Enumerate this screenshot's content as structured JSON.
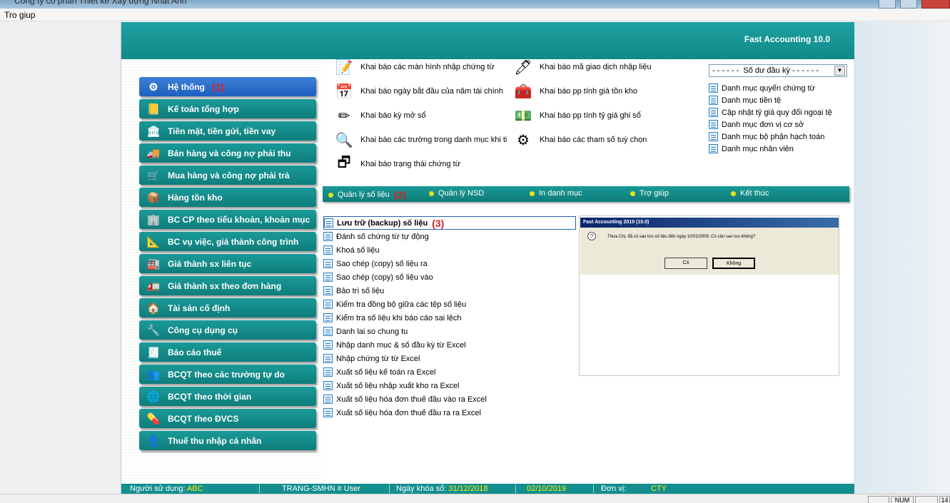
{
  "window": {
    "title": "Công ty cổ phần Thiết kế Xây dựng Nhật Anh"
  },
  "menu": {
    "help": "Tro giup"
  },
  "header": {
    "product": "Fast Accounting 10.0"
  },
  "sidebar": {
    "items": [
      {
        "label": "Hệ thống",
        "num": "(1)",
        "icon": "gear-icon"
      },
      {
        "label": "Kế toán tổng hợp",
        "icon": "ledger-icon"
      },
      {
        "label": "Tiền mặt, tiền gửi, tiền vay",
        "icon": "bank-icon"
      },
      {
        "label": "Bán hàng và công nợ phải thu",
        "icon": "truck-icon"
      },
      {
        "label": "Mua hàng và công nợ phải trả",
        "icon": "cart-icon"
      },
      {
        "label": "Hàng tồn kho",
        "icon": "warehouse-icon"
      },
      {
        "label": "BC CP theo tiểu khoản, khoản mục",
        "icon": "building-icon"
      },
      {
        "label": "BC vụ việc, giá thành công trình",
        "icon": "construction-icon"
      },
      {
        "label": "Giá thành sx liên tục",
        "icon": "conveyor-icon"
      },
      {
        "label": "Giá thành sx theo đơn hàng",
        "icon": "delivery-icon"
      },
      {
        "label": "Tài sản cố định",
        "icon": "house-icon"
      },
      {
        "label": "Công cụ dụng cụ",
        "icon": "tools-icon"
      },
      {
        "label": "Báo cáo thuế",
        "icon": "tax-report-icon"
      },
      {
        "label": "BCQT theo các trường tự do",
        "icon": "people-icon"
      },
      {
        "label": "BCQT theo thời gian",
        "icon": "globe-icon"
      },
      {
        "label": "BCQT theo ĐVCS",
        "icon": "pill-icon"
      },
      {
        "label": "Thuế thu nhập cá nhân",
        "icon": "person-icon"
      }
    ]
  },
  "config": {
    "items": [
      {
        "label": "Khai báo các màn hình nhập chứng từ",
        "icon": "form-edit-icon"
      },
      {
        "label": "Khai báo ngày bắt đầu của năm tài chính",
        "icon": "calendar-icon"
      },
      {
        "label": "Khai báo kỳ mở sổ",
        "icon": "tools-pencil-icon"
      },
      {
        "label": "Khai báo các trường trong danh mục khi ti",
        "icon": "magnifier-icon"
      },
      {
        "label": "Khai báo trạng thái chứng từ",
        "icon": "windows-icon"
      },
      {
        "label": "Khai báo mã giao dịch nhập liệu",
        "icon": "document-pen-icon"
      },
      {
        "label": "Khai báo pp tính giá tồn kho",
        "icon": "boxes-icon"
      },
      {
        "label": "Khai báo pp tính tỷ giá ghi sổ",
        "icon": "money-icon"
      },
      {
        "label": "Khai báo các tham số tuỳ chọn",
        "icon": "cogs-icon"
      }
    ]
  },
  "opening": {
    "combo": "- - - - - -  Số dư đầu kỳ - - - - - -",
    "items": [
      "Danh mục quyển chứng từ",
      "Danh mục tiền tệ",
      "Cập nhật tỷ giá quy đổi ngoại tệ",
      "Danh mục đơn vị cơ sở",
      "Danh mục bộ phận hạch toán",
      "Danh mục nhân viên"
    ]
  },
  "subbar": {
    "items": [
      {
        "label": "Quản lý số liệu",
        "num": "(2)"
      },
      {
        "label": "Quản lý NSD"
      },
      {
        "label": "In danh mục"
      },
      {
        "label": "Trợ giúp"
      },
      {
        "label": "Kết thúc"
      }
    ]
  },
  "functions": {
    "selected": {
      "label": "Lưu trữ (backup) số liệu",
      "num": "(3)"
    },
    "items": [
      "Đánh số chứng từ tự động",
      "Khoá số liệu",
      "Sao chép (copy) số liệu ra",
      "Sao chép (copy) số liệu vào",
      "Bảo trì số liệu",
      "Kiểm tra đồng bộ giữa các tệp số liệu",
      "Kiểm tra số liệu khi báo cáo sai lệch",
      "Danh lai so chung tu",
      "Nhập danh mục & số đầu kỳ từ Excel",
      "Nhập chứng từ từ Excel",
      "Xuất số liệu kế toán ra Excel",
      "Xuất số liệu nhập xuất kho ra Excel",
      "Xuất số liệu hóa đơn thuế đầu vào ra Excel",
      "Xuất số liệu hóa đơn thuế đầu ra ra Excel"
    ]
  },
  "preview": {
    "title": "Fast Accounting 2010 (10.0)",
    "message": "Thưa Chị, đã có sao lưu số liệu đến ngày 10/02/2009. Có cần sao lưu không?",
    "yes": "Có",
    "no": "Không"
  },
  "status": {
    "user_label": "Người sử dụng:",
    "user_value": "ABC",
    "db": "TRANG-SMHN # User",
    "lock_label": "Ngày khóa sổ:",
    "lock_value": "31/12/2018",
    "date": "02/10/2019",
    "unit_label": "Đơn vị:",
    "unit_value": "CTY"
  },
  "os": {
    "num": "NUM",
    "page": "14"
  }
}
